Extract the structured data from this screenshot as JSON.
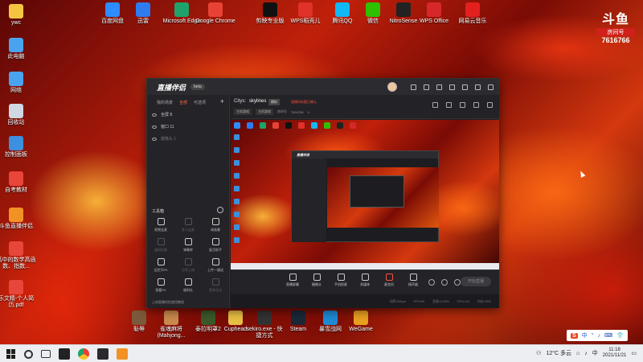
{
  "desktop": {
    "top_icons": [
      {
        "label": "百度网盘",
        "color": "#2e8cff"
      },
      {
        "label": "迅雷",
        "color": "#2f7bf0"
      },
      {
        "label": "Microsoft Edge",
        "color": "#1fa36a"
      },
      {
        "label": "Google Chrome",
        "color": "#e84236"
      },
      {
        "label": "剪映专业版",
        "color": "#111111"
      },
      {
        "label": "WPS稻壳儿",
        "color": "#e0312a"
      },
      {
        "label": "腾讯QQ",
        "color": "#12b7f5"
      },
      {
        "label": "微信",
        "color": "#2dc100"
      },
      {
        "label": "NitroSense",
        "color": "#222222"
      },
      {
        "label": "WPS Office",
        "color": "#d6282a"
      },
      {
        "label": "网易云音乐",
        "color": "#e3201e"
      }
    ],
    "left_icons": [
      {
        "label": "ywc",
        "color": "#f5c542"
      },
      {
        "label": "此电脑",
        "color": "#4aa3ef"
      },
      {
        "label": "网络",
        "color": "#4aa3ef"
      },
      {
        "label": "回收站",
        "color": "#cfd8e3"
      },
      {
        "label": "控制面板",
        "color": "#3d8fe0"
      },
      {
        "label": "自考教材",
        "color": "#e8463a"
      },
      {
        "label": "斗鱼直播伴侣",
        "color": "#f29224"
      },
      {
        "label": "高中的数学高函数、指数...",
        "color": "#e8463a"
      },
      {
        "label": "乐文精-个人简历.pdf",
        "color": "#e8463a"
      }
    ],
    "bottom_icons": [
      {
        "label": "耻辱",
        "color": "#7a5a3a"
      },
      {
        "label": "雀魂麻将 (Mahjong...",
        "color": "#c98a4e"
      },
      {
        "label": "泰拉明罩2",
        "color": "#3a5a2a"
      },
      {
        "label": "Cuphead",
        "color": "#e8c044"
      },
      {
        "label": "sekiro.exe - 快捷方式",
        "color": "#333333"
      },
      {
        "label": "Steam",
        "color": "#1b2838"
      },
      {
        "label": "暴雪战网",
        "color": "#1e8bd6"
      },
      {
        "label": "WeGame",
        "color": "#e8a020"
      }
    ]
  },
  "douyu": {
    "logo": "斗鱼",
    "room_label": "房间号",
    "room_number": "7616766"
  },
  "app": {
    "logo_text": "直播伴侣",
    "version_badge": "beta",
    "left_tabs": [
      "我的场景",
      "全部",
      "可选项"
    ],
    "scenes": [
      {
        "label": "全屏 8"
      },
      {
        "label": "窗口 11"
      },
      {
        "label": "摄像头 1"
      }
    ],
    "tools_title": "工具箱",
    "tools": [
      {
        "label": "视频连麦",
        "dim": false
      },
      {
        "label": "多人连麦",
        "dim": true
      },
      {
        "label": "调画幕",
        "dim": false
      },
      {
        "label": "虚拟形象",
        "dim": true
      },
      {
        "label": "弹幕库",
        "dim": false
      },
      {
        "label": "复活助手",
        "dim": false
      },
      {
        "label": "全民开PK",
        "dim": false
      },
      {
        "label": "分享上场",
        "dim": true
      },
      {
        "label": "上传一键送",
        "dim": false
      },
      {
        "label": "观看PK",
        "dim": false
      },
      {
        "label": "福利社",
        "dim": false
      },
      {
        "label": "更多玩法",
        "dim": true
      }
    ],
    "left_footer": "上热直播伴侣使用教程",
    "city_label": "Citys:",
    "city_value": "skylines",
    "category_tag": "模拟",
    "warning": "直播间标题已确认",
    "sub_tags": [
      "主机游戏",
      "主机游戏"
    ],
    "sub_info": [
      "房间号",
      "7616766",
      "0"
    ],
    "bottom_tools": [
      {
        "label": "直播屏幕"
      },
      {
        "label": "摄像头"
      },
      {
        "label": "手机投屏"
      },
      {
        "label": "多媒体"
      },
      {
        "label": "麦克风",
        "red": true
      },
      {
        "label": "扬声器"
      }
    ],
    "start_button": "开始直播",
    "status_items": [
      "码率:0kbps",
      "FPS:60",
      "丢帧:0.00%",
      "CPU:1%",
      "内存:25%"
    ]
  },
  "taskbar": {
    "weather": "12°C 多云",
    "ime_items": [
      "中",
      "°",
      "♪",
      "⌨",
      "👕"
    ],
    "ime_logo": "S",
    "time": "11:18",
    "date": "2021/11/21"
  }
}
